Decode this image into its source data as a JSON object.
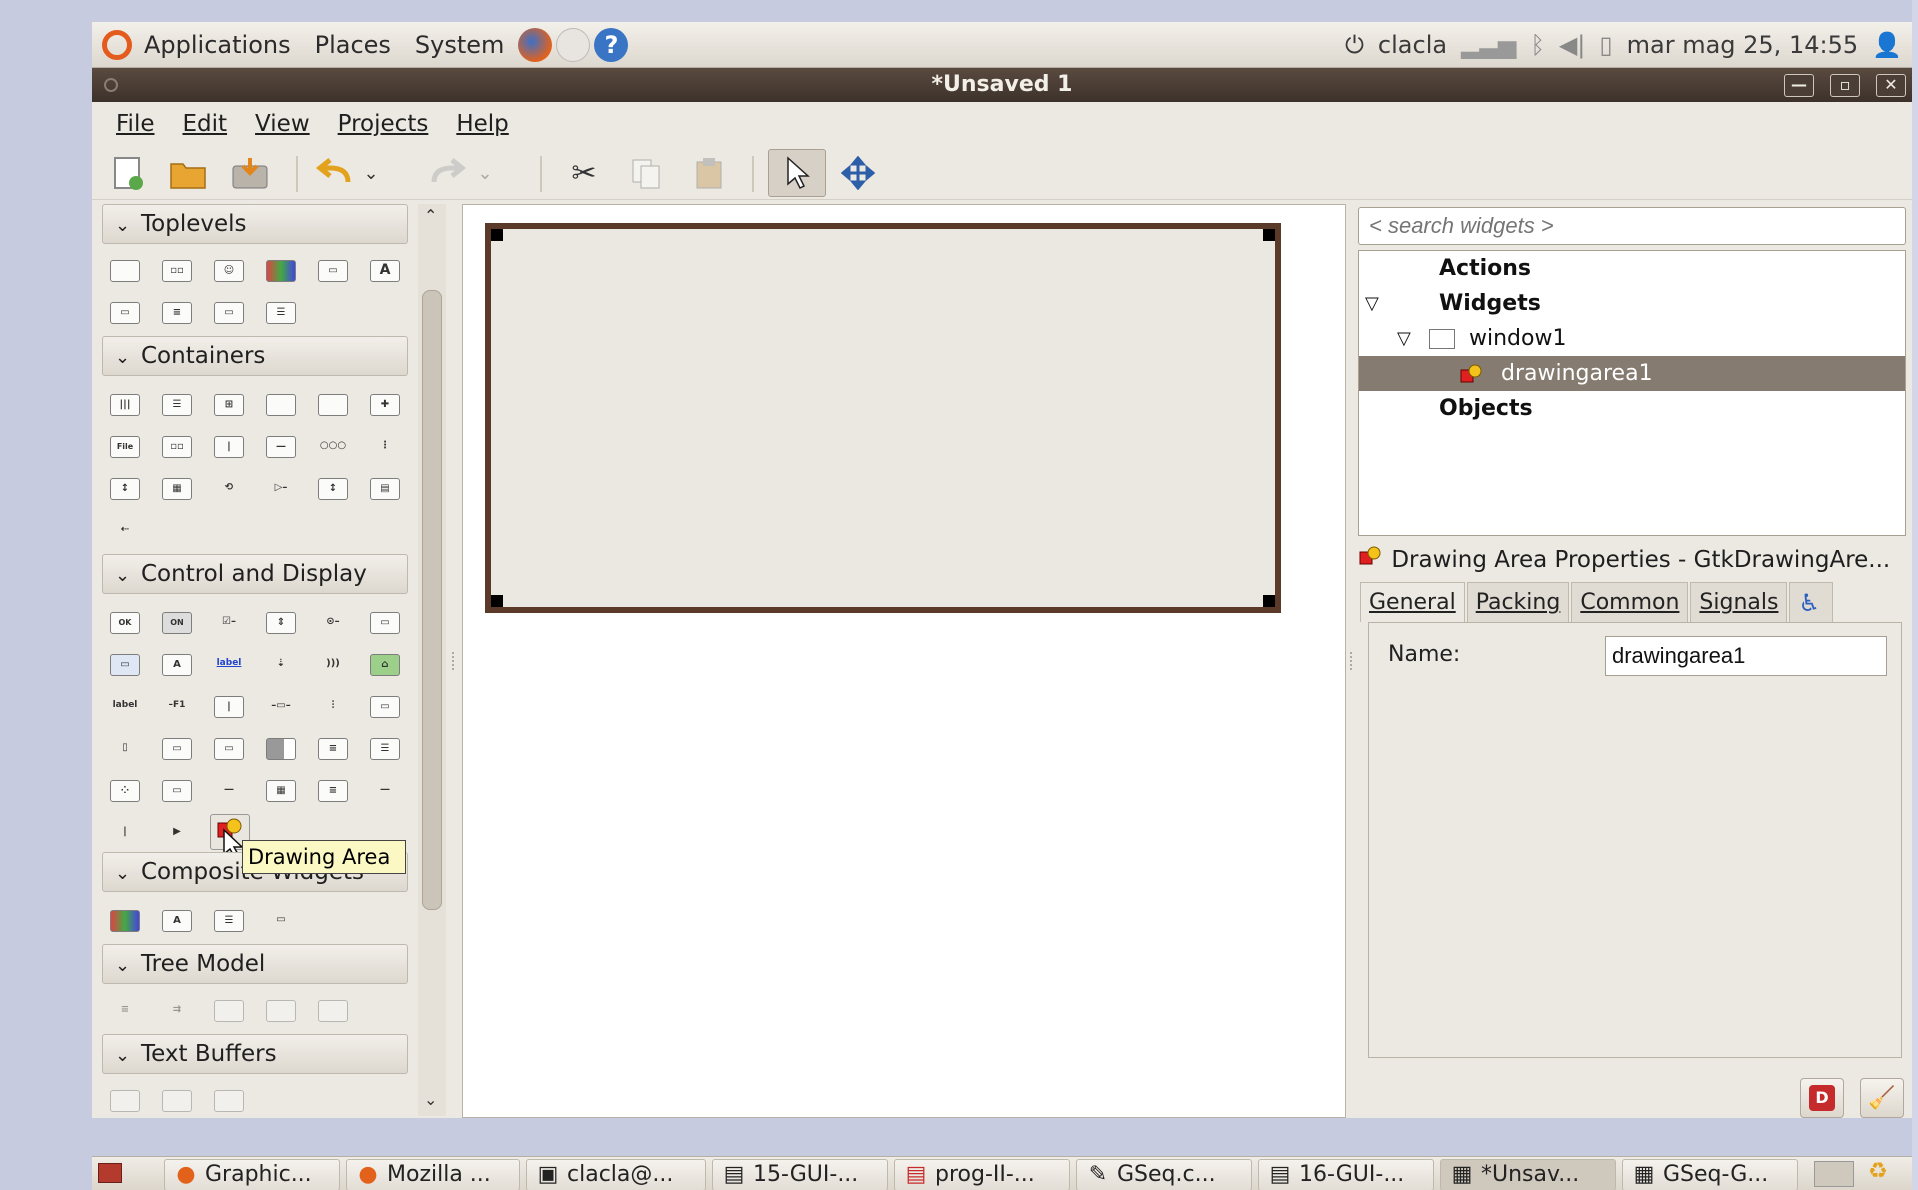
{
  "top_panel": {
    "menus": [
      "Applications",
      "Places",
      "System"
    ],
    "user": "clacla",
    "datetime": "mar mag 25, 14:55"
  },
  "window": {
    "title": "*Unsaved 1",
    "menus": [
      "File",
      "Edit",
      "View",
      "Projects",
      "Help"
    ]
  },
  "palette": {
    "categories": [
      "Toplevels",
      "Containers",
      "Control and Display",
      "Composite Widgets",
      "Tree Model",
      "Text Buffers"
    ],
    "tooltip": "Drawing Area"
  },
  "inspector": {
    "search_placeholder": "< search widgets >",
    "tree": {
      "actions": "Actions",
      "widgets": "Widgets",
      "window1": "window1",
      "drawingarea1": "drawingarea1",
      "objects": "Objects"
    }
  },
  "properties": {
    "header": "Drawing Area Properties - GtkDrawingAre...",
    "tabs": [
      "General",
      "Packing",
      "Common",
      "Signals"
    ],
    "name_label": "Name:",
    "name_value": "drawingarea1"
  },
  "taskbar": {
    "tasks": [
      "Graphic...",
      "Mozilla ...",
      "clacla@...",
      "15-GUI-...",
      "prog-II-...",
      "GSeq.c...",
      "16-GUI-...",
      "*Unsav...",
      "GSeq-G..."
    ]
  },
  "colors": {
    "selection": "#867b70",
    "titlebar": "#3c322b",
    "drawing_border": "#5b3a2a"
  }
}
